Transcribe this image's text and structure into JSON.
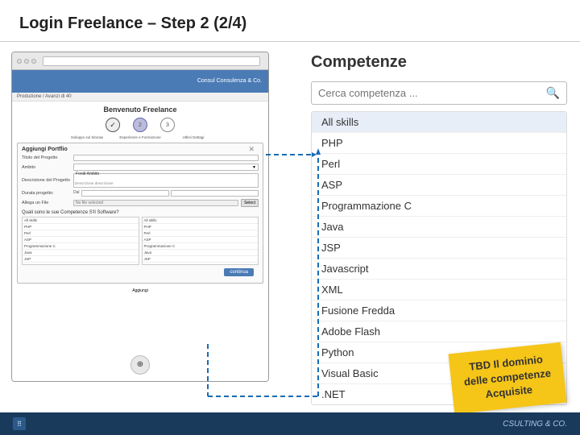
{
  "header": {
    "title": "Login Freelance – Step 2 (2/4)"
  },
  "mockup": {
    "header_text": "Consul\nConsulenza & Co.",
    "breadcrumb": "Produzione / Avanzi di 40",
    "step_title": "Benvenuto Freelance",
    "steps": [
      {
        "label": "check",
        "type": "done"
      },
      {
        "label": "2",
        "type": "current"
      },
      {
        "label": "3",
        "type": "upcoming"
      }
    ],
    "step_labels": [
      "Sviluppo sul Sito/aw",
      "Esperienze e Formazione",
      "Ultimi Dettagi"
    ],
    "form_title": "Aggiungi Portflio",
    "form_fields": [
      {
        "label": "Titolo del Progetto",
        "type": "input",
        "value": ""
      },
      {
        "label": "Ambito",
        "type": "select",
        "value": "Fondi Ambito"
      },
      {
        "label": "Descrizione del Progetto",
        "type": "textarea",
        "value": "Descrizione descrizione"
      },
      {
        "label": "Durata progetto:",
        "type": "date_range",
        "value": ""
      },
      {
        "label": "Allega un File",
        "type": "file",
        "value": "No file selected"
      }
    ],
    "competenze_label": "Quali sono le sue Competenze S'Il Software?",
    "competenze_columns": [
      [
        "All skills",
        "PHP",
        "Perl",
        "ASP",
        "Programmazione C",
        "Java",
        "JSP"
      ],
      [
        "All skills",
        "PHP",
        "Perl",
        "ASP",
        "Programmazione C",
        "Java",
        "JSP"
      ]
    ],
    "continue_label": "continua",
    "aggiungi_label": "Aggiungi"
  },
  "competenze": {
    "title": "Competenze",
    "search_placeholder": "Cerca competenza ...",
    "skills": [
      {
        "name": "All skills",
        "highlighted": true
      },
      {
        "name": "PHP",
        "highlighted": false
      },
      {
        "name": "Perl",
        "highlighted": false
      },
      {
        "name": "ASP",
        "highlighted": false
      },
      {
        "name": "Programmazione C",
        "highlighted": false
      },
      {
        "name": "Java",
        "highlighted": false
      },
      {
        "name": "JSP",
        "highlighted": false
      },
      {
        "name": "Javascript",
        "highlighted": false
      },
      {
        "name": "XML",
        "highlighted": false
      },
      {
        "name": "Fusione Fredda",
        "highlighted": false
      },
      {
        "name": "Adobe Flash",
        "highlighted": false
      },
      {
        "name": "Python",
        "highlighted": false
      },
      {
        "name": "Visual Basic",
        "highlighted": false
      },
      {
        "name": ".NET",
        "highlighted": false
      }
    ]
  },
  "tbd_sticker": {
    "line1": "TBD Il dominio",
    "line2": "delle competenze",
    "line3": "Acquisite"
  },
  "bottom_bar": {
    "brand": "SULTING & CO."
  }
}
